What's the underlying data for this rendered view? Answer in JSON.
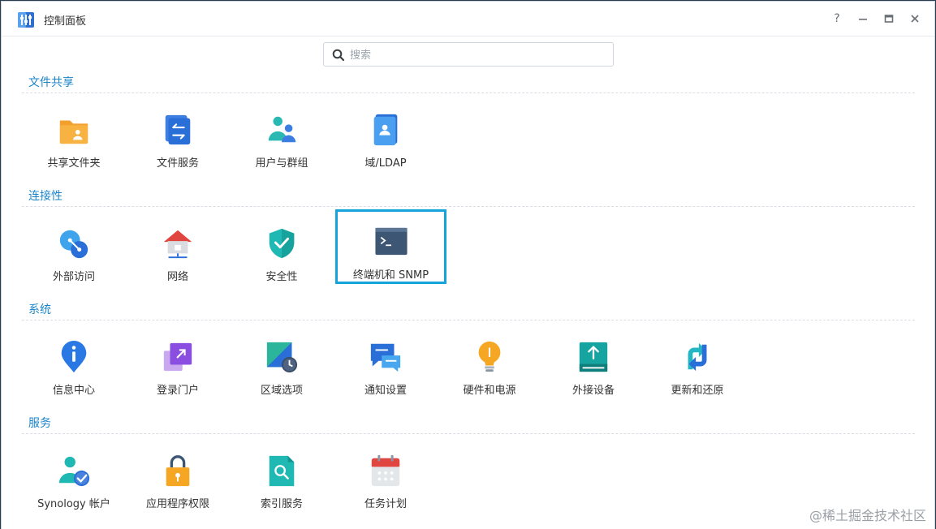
{
  "window": {
    "title": "控制面板",
    "controls": {
      "help": "?",
      "minimize": "—",
      "maximize": "▭",
      "close": "✕"
    }
  },
  "search": {
    "placeholder": "搜索",
    "value": ""
  },
  "sections": [
    {
      "title": "文件共享",
      "items": [
        {
          "label": "共享文件夹",
          "icon": "shared-folder-icon"
        },
        {
          "label": "文件服务",
          "icon": "file-services-icon"
        },
        {
          "label": "用户与群组",
          "icon": "user-group-icon"
        },
        {
          "label": "域/LDAP",
          "icon": "domain-ldap-icon"
        }
      ]
    },
    {
      "title": "连接性",
      "items": [
        {
          "label": "外部访问",
          "icon": "external-access-icon"
        },
        {
          "label": "网络",
          "icon": "network-icon"
        },
        {
          "label": "安全性",
          "icon": "security-shield-icon"
        },
        {
          "label": "终端机和 SNMP",
          "icon": "terminal-icon",
          "selected": true
        }
      ]
    },
    {
      "title": "系统",
      "items": [
        {
          "label": "信息中心",
          "icon": "info-center-icon"
        },
        {
          "label": "登录门户",
          "icon": "login-portal-icon"
        },
        {
          "label": "区域选项",
          "icon": "regional-options-icon"
        },
        {
          "label": "通知设置",
          "icon": "notification-icon"
        },
        {
          "label": "硬件和电源",
          "icon": "hardware-power-icon"
        },
        {
          "label": "外接设备",
          "icon": "external-devices-icon"
        },
        {
          "label": "更新和还原",
          "icon": "update-restore-icon"
        }
      ]
    },
    {
      "title": "服务",
      "items": [
        {
          "label": "Synology 帐户",
          "icon": "synology-account-icon"
        },
        {
          "label": "应用程序权限",
          "icon": "app-privileges-icon"
        },
        {
          "label": "索引服务",
          "icon": "indexing-service-icon"
        },
        {
          "label": "任务计划",
          "icon": "task-scheduler-icon"
        }
      ]
    }
  ],
  "colors": {
    "accent": "#1b85c9",
    "selection": "#16a3d9"
  },
  "watermark": "@稀土掘金技术社区"
}
